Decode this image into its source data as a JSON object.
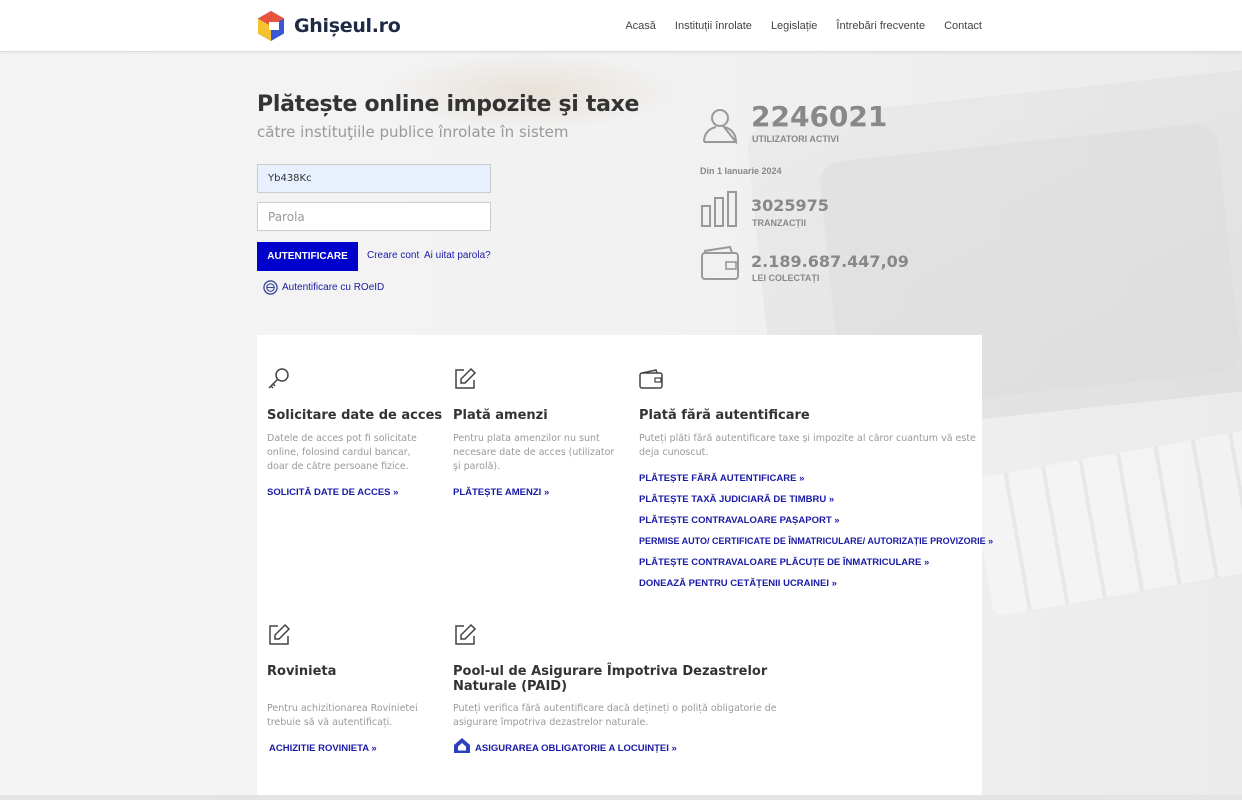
{
  "brand": {
    "name": "Ghișeul.ro"
  },
  "nav": {
    "items": [
      "Acasă",
      "Instituții înrolate",
      "Legislație",
      "Întrebări frecvente",
      "Contact"
    ]
  },
  "hero": {
    "title": "Plătește online impozite şi taxe",
    "subtitle": "către instituţiile publice înrolate în sistem"
  },
  "login": {
    "username_value": "Yb438Kc",
    "password_placeholder": "Parola",
    "submit_label": "AUTENTIFICARE",
    "create_account": "Creare cont",
    "forgot_password": "Ai uitat parola?",
    "roeid_label": "Autentificare cu ROeID"
  },
  "stats": {
    "users_count": "2246021",
    "users_label": "UTILIZATORI ACTIVI",
    "since_label": "Din 1 Ianuarie 2024",
    "transactions_count": "3025975",
    "transactions_label": "TRANZACȚII",
    "collected_amount": "2.189.687.447,09",
    "collected_label": "LEI COLECTAȚI"
  },
  "cards": {
    "access": {
      "title": "Solicitare date de acces",
      "desc": "Datele de acces pot fi solicitate online, folosind cardul bancar, doar de către persoane fizice.",
      "link": "SOLICITĂ DATE DE ACCES »"
    },
    "fines": {
      "title": "Plată amenzi",
      "desc": "Pentru plata amenzilor nu sunt necesare date de acces (utilizator şi parolă).",
      "link": "PLĂTEȘTE AMENZI »"
    },
    "noauth": {
      "title": "Plată fără autentificare",
      "desc": "Puteți plăti fără autentificare taxe și impozite al căror cuantum vă este deja cunoscut.",
      "links": [
        "PLĂTEȘTE FĂRĂ AUTENTIFICARE »",
        "PLĂTEȘTE TAXĂ JUDICIARĂ DE TIMBRU »",
        "PLĂTEȘTE CONTRAVALOARE PAȘAPORT »",
        "PERMISE AUTO/ CERTIFICATE DE ÎNMATRICULARE/ AUTORIZAȚIE PROVIZORIE »",
        "PLĂTEȘTE CONTRAVALOARE PLĂCUȚE DE ÎNMATRICULARE »",
        "DONEAZĂ PENTRU CETĂȚENII UCRAINEI »"
      ]
    },
    "rovinieta": {
      "title": "Rovinieta",
      "desc": "Pentru achizitionarea Rovinietei trebuie să vă autentificați.",
      "link": "ACHIZITIE ROVINIETA »"
    },
    "paid": {
      "title": "Pool-ul de Asigurare Împotriva Dezastrelor Naturale (PAID)",
      "desc": "Puteți verifica fără autentificare dacă dețineți o poliță obligatorie de asigurare împotriva dezastrelor naturale.",
      "link": "ASIGURAREA OBLIGATORIE A LOCUINȚEI »"
    }
  },
  "colors": {
    "primary_button": "#0000cc",
    "link": "#1a1aa6"
  }
}
